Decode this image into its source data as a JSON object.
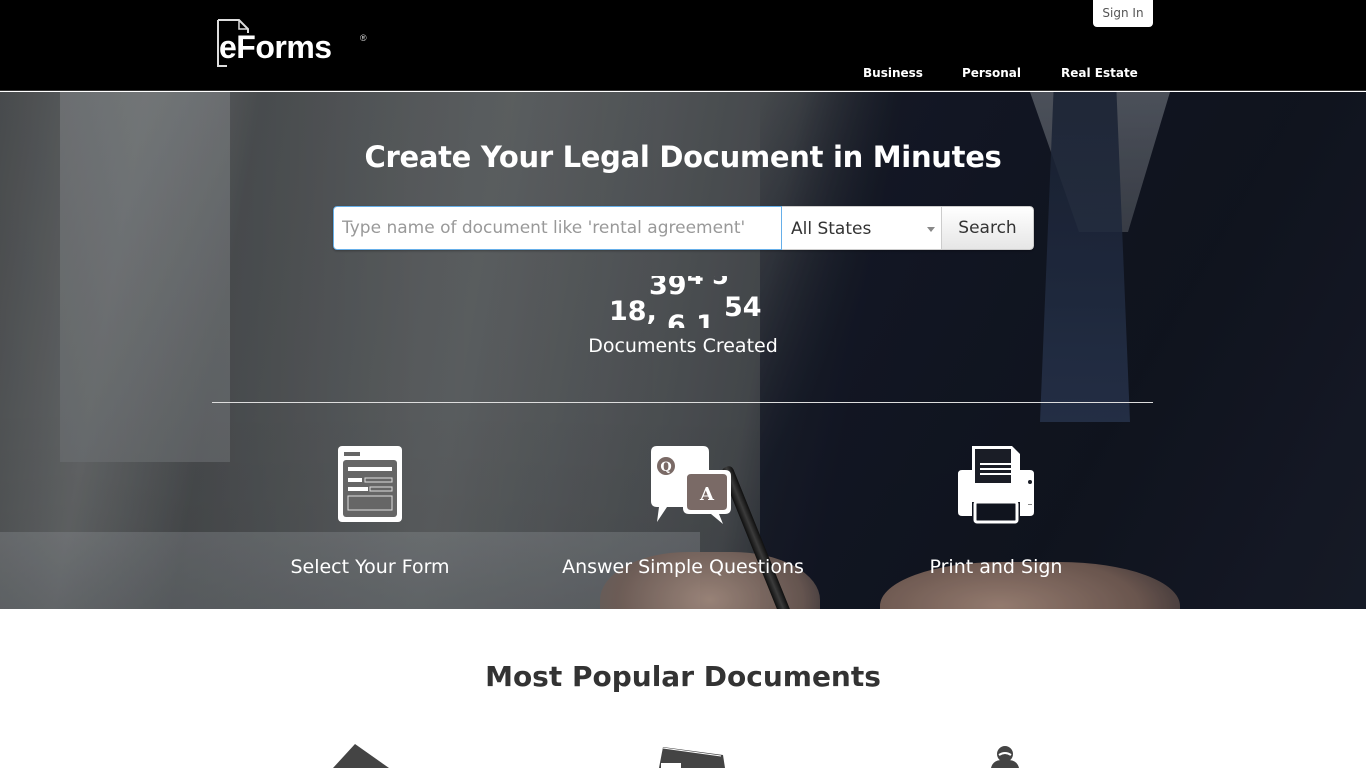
{
  "header": {
    "logo": {
      "text": "eForms",
      "registered": "®"
    },
    "sign_in": "Sign In",
    "nav": [
      "Business",
      "Personal",
      "Real Estate"
    ]
  },
  "hero": {
    "title": "Create Your Legal Document in Minutes",
    "search": {
      "placeholder": "Type name of document like 'rental agreement'",
      "value": "",
      "state_selected": "All States",
      "button": "Search"
    },
    "counter": {
      "visible_fragments": {
        "top": "39",
        "left": "18,",
        "bottom": "6,1",
        "right": "54"
      },
      "label": "Documents Created"
    },
    "steps": [
      {
        "icon": "form-icon",
        "label": "Select Your Form"
      },
      {
        "icon": "question-answer-icon",
        "label": "Answer Simple Questions"
      },
      {
        "icon": "printer-icon",
        "label": "Print and Sign"
      }
    ]
  },
  "popular": {
    "title": "Most Popular Documents",
    "icons": [
      "house-icon",
      "document-stack-icon",
      "person-icon"
    ]
  },
  "colors": {
    "header_bg": "#000000",
    "popular_title": "#333333",
    "input_focus_border": "#66afe9"
  }
}
